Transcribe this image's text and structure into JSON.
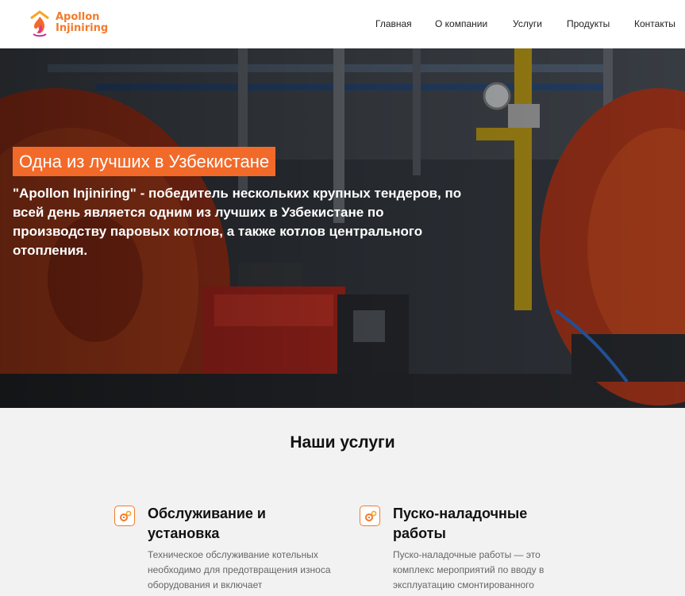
{
  "header": {
    "logo": {
      "line1": "Apollon",
      "line2": "Injiniring"
    },
    "nav": [
      {
        "label": "Главная"
      },
      {
        "label": "О компании"
      },
      {
        "label": "Услуги"
      },
      {
        "label": "Продукты"
      },
      {
        "label": "Контакты"
      }
    ]
  },
  "hero": {
    "badge": "Одна из лучших в Узбекистане",
    "description": "\"Apollon Injiniring\" - победитель нескольких крупных тендеров, по всей день является одним из лучших в Узбекистане по производству паровых котлов, а также котлов центрального отопления."
  },
  "services": {
    "title": "Наши услуги",
    "items": [
      {
        "icon": "gears-icon",
        "title": "Обслуживание и установка",
        "description": "Техническое обслуживание котельных необходимо для предотвращения износа оборудования и включает"
      },
      {
        "icon": "gears-icon",
        "title": "Пуско-наладочные работы",
        "description": "Пуско-наладочные работы — это комплекс мероприятий по вводу в эксплуатацию смонтированного"
      }
    ]
  },
  "colors": {
    "accent": "#f26a2a",
    "header_bg": "#ffffff",
    "section_bg": "#f2f2f2"
  }
}
